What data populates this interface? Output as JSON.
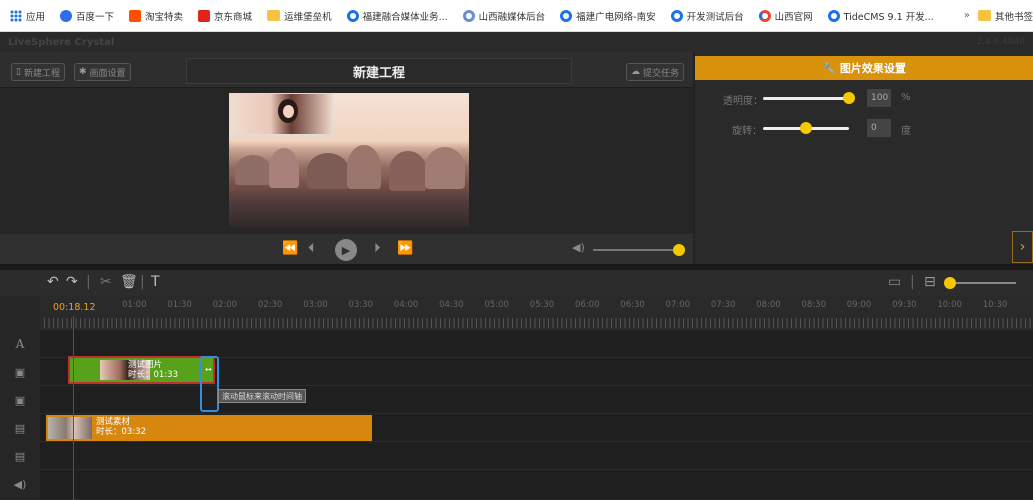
{
  "bookmarks": [
    {
      "label": "应用",
      "icon": "apps-grid-icon"
    },
    {
      "label": "百度一下",
      "icon": "baidu-icon"
    },
    {
      "label": "淘宝特卖",
      "icon": "taobao-icon"
    },
    {
      "label": "京东商城",
      "icon": "jd-icon"
    },
    {
      "label": "运维堡垒机",
      "icon": "folder-icon"
    },
    {
      "label": "福建融合媒体业务...",
      "icon": "globe-icon"
    },
    {
      "label": "山西融媒体后台",
      "icon": "globe-icon"
    },
    {
      "label": "福建广电网络-南安",
      "icon": "globe-icon"
    },
    {
      "label": "开发测试后台",
      "icon": "globe-icon"
    },
    {
      "label": "山西官网",
      "icon": "globe-icon"
    },
    {
      "label": "TideCMS 9.1 开发...",
      "icon": "globe-icon"
    }
  ],
  "bookmarks_more": "»",
  "bookmarks_other": "其他书签",
  "app": {
    "title": "LiveSphere Crystal",
    "version": "2.4.6.4840"
  },
  "toolbar": {
    "new_project_label": "新建工程",
    "screen_settings_label": "画面设置",
    "project_title": "新建工程",
    "submit_label": "提交任务"
  },
  "effects_panel": {
    "title": "图片效果设置",
    "opacity_label": "透明度：",
    "opacity_value": "100",
    "opacity_unit": "%",
    "opacity_fraction": 1.0,
    "rotate_label": "旋转：",
    "rotate_value": "0",
    "rotate_unit": "度",
    "rotate_fraction": 0.5
  },
  "player": {
    "volume_fraction": 0.95
  },
  "timeline": {
    "current_time": "00:18.12",
    "ticks": [
      "01:00",
      "01:30",
      "02:00",
      "02:30",
      "03:00",
      "03:30",
      "04:00",
      "04:30",
      "05:00",
      "05:30",
      "06:00",
      "06:30",
      "07:00",
      "07:30",
      "08:00",
      "08:30",
      "09:00",
      "09:30",
      "10:00",
      "10:30"
    ],
    "tracks": [
      {
        "type": "text",
        "icon": "A"
      },
      {
        "type": "image",
        "icon": "image-icon"
      },
      {
        "type": "image",
        "icon": "image-icon"
      },
      {
        "type": "video",
        "icon": "film-icon"
      },
      {
        "type": "video",
        "icon": "film-icon"
      },
      {
        "type": "audio",
        "icon": "speaker-icon"
      }
    ],
    "image_clip": {
      "name": "测试图片",
      "duration": "时长：01:33"
    },
    "video_clip": {
      "name": "测试素材",
      "duration": "时长：03:32"
    },
    "tooltip": "滚动鼠标来滚动时间轴"
  },
  "colors": {
    "accent": "#d9920c",
    "knob": "#f5c800",
    "image_clip": "#57a11b",
    "video_clip": "#d7870e",
    "playhead": "#d21b1b",
    "highlight": "#3390e0"
  }
}
